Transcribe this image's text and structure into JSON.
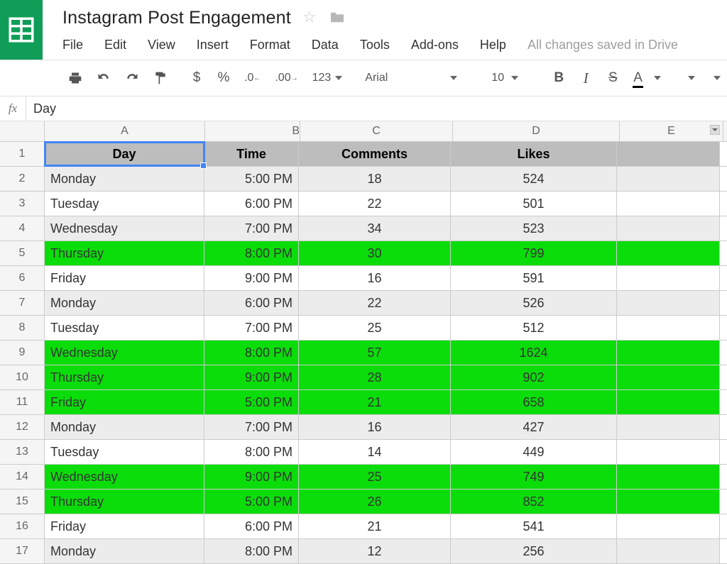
{
  "doc_title": "Instagram Post Engagement",
  "saved_text": "All changes saved in Drive",
  "menus": [
    "File",
    "Edit",
    "View",
    "Insert",
    "Format",
    "Data",
    "Tools",
    "Add-ons",
    "Help"
  ],
  "toolbar": {
    "currency": "$",
    "percent": "%",
    "dec_dec": ".0",
    "dec_inc": ".00",
    "num_fmt": "123",
    "font": "Arial",
    "font_size": "10",
    "bold": "B",
    "italic": "I",
    "strike": "S",
    "text_color": "A"
  },
  "fx": {
    "label": "fx",
    "value": "Day"
  },
  "columns": [
    "A",
    "B",
    "C",
    "D",
    "E"
  ],
  "table": {
    "headers": [
      "Day",
      "Time",
      "Comments",
      "Likes"
    ],
    "rows": [
      {
        "n": 1,
        "bg": "header"
      },
      {
        "n": 2,
        "bg": "alt",
        "day": "Monday",
        "time": "5:00 PM",
        "comments": "18",
        "likes": "524"
      },
      {
        "n": 3,
        "bg": "",
        "day": "Tuesday",
        "time": "6:00 PM",
        "comments": "22",
        "likes": "501"
      },
      {
        "n": 4,
        "bg": "alt",
        "day": "Wednesday",
        "time": "7:00 PM",
        "comments": "34",
        "likes": "523"
      },
      {
        "n": 5,
        "bg": "hl",
        "day": "Thursday",
        "time": "8:00 PM",
        "comments": "30",
        "likes": "799"
      },
      {
        "n": 6,
        "bg": "",
        "day": "Friday",
        "time": "9:00 PM",
        "comments": "16",
        "likes": "591"
      },
      {
        "n": 7,
        "bg": "alt",
        "day": "Monday",
        "time": "6:00 PM",
        "comments": "22",
        "likes": "526"
      },
      {
        "n": 8,
        "bg": "",
        "day": "Tuesday",
        "time": "7:00 PM",
        "comments": "25",
        "likes": "512"
      },
      {
        "n": 9,
        "bg": "hl",
        "day": "Wednesday",
        "time": "8:00 PM",
        "comments": "57",
        "likes": "1624"
      },
      {
        "n": 10,
        "bg": "hl",
        "day": "Thursday",
        "time": "9:00 PM",
        "comments": "28",
        "likes": "902"
      },
      {
        "n": 11,
        "bg": "hl",
        "day": "Friday",
        "time": "5:00 PM",
        "comments": "21",
        "likes": "658"
      },
      {
        "n": 12,
        "bg": "alt",
        "day": "Monday",
        "time": "7:00 PM",
        "comments": "16",
        "likes": "427"
      },
      {
        "n": 13,
        "bg": "",
        "day": "Tuesday",
        "time": "8:00 PM",
        "comments": "14",
        "likes": "449"
      },
      {
        "n": 14,
        "bg": "hl",
        "day": "Wednesday",
        "time": "9:00 PM",
        "comments": "25",
        "likes": "749"
      },
      {
        "n": 15,
        "bg": "hl",
        "day": "Thursday",
        "time": "5:00 PM",
        "comments": "26",
        "likes": "852"
      },
      {
        "n": 16,
        "bg": "",
        "day": "Friday",
        "time": "6:00 PM",
        "comments": "21",
        "likes": "541"
      },
      {
        "n": 17,
        "bg": "alt",
        "day": "Monday",
        "time": "8:00 PM",
        "comments": "12",
        "likes": "256"
      }
    ]
  }
}
